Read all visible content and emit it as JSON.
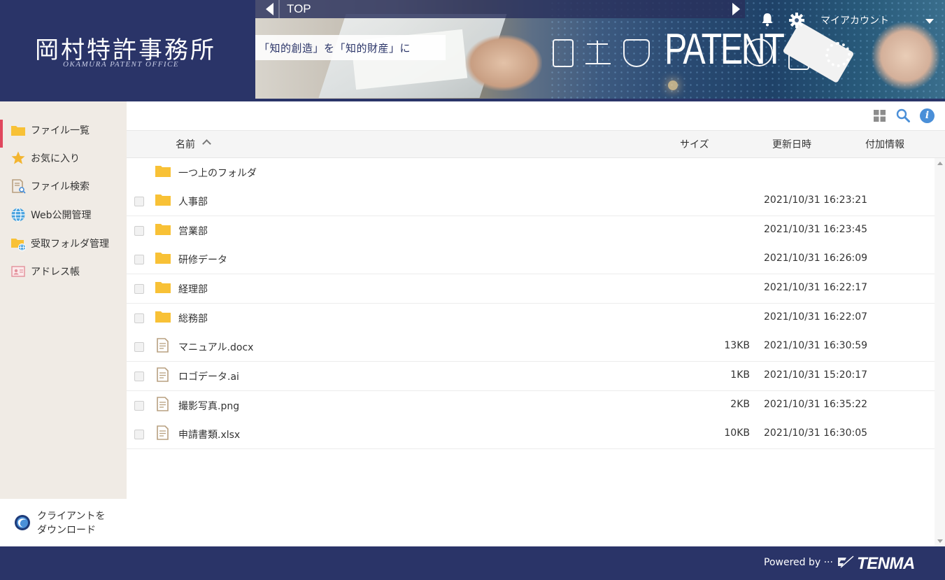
{
  "header": {
    "logo_jp": "岡村特許事務所",
    "logo_en": "OKAMURA PATENT OFFICE",
    "breadcrumb_label": "TOP",
    "tagline": "「知的創造」を「知的財産」に",
    "banner_text": "PATENT",
    "account_label": "マイアカウント"
  },
  "sidebar": {
    "items": [
      {
        "label": "ファイル一覧",
        "icon": "folder-icon"
      },
      {
        "label": "お気に入り",
        "icon": "star-icon"
      },
      {
        "label": "ファイル検索",
        "icon": "file-search-icon"
      },
      {
        "label": "Web公開管理",
        "icon": "globe-icon"
      },
      {
        "label": "受取フォルダ管理",
        "icon": "folder-globe-icon"
      },
      {
        "label": "アドレス帳",
        "icon": "address-book-icon"
      }
    ],
    "active_index": 0,
    "download_label": "クライアントを\nダウンロード"
  },
  "table": {
    "columns": {
      "name": "名前",
      "size": "サイズ",
      "updated": "更新日時",
      "extra": "付加情報"
    },
    "parent_folder": "一つ上のフォルダ",
    "rows": [
      {
        "name": "人事部",
        "type": "folder",
        "size": "",
        "updated": "2021/10/31 16:23:21"
      },
      {
        "name": "営業部",
        "type": "folder",
        "size": "",
        "updated": "2021/10/31 16:23:45"
      },
      {
        "name": "研修データ",
        "type": "folder",
        "size": "",
        "updated": "2021/10/31 16:26:09"
      },
      {
        "name": "経理部",
        "type": "folder",
        "size": "",
        "updated": "2021/10/31 16:22:17"
      },
      {
        "name": "総務部",
        "type": "folder",
        "size": "",
        "updated": "2021/10/31 16:22:07"
      },
      {
        "name": "マニュアル.docx",
        "type": "file",
        "size": "13KB",
        "updated": "2021/10/31 16:30:59"
      },
      {
        "name": "ロゴデータ.ai",
        "type": "file",
        "size": "1KB",
        "updated": "2021/10/31 15:20:17"
      },
      {
        "name": "撮影写真.png",
        "type": "file",
        "size": "2KB",
        "updated": "2021/10/31 16:35:22"
      },
      {
        "name": "申請書類.xlsx",
        "type": "file",
        "size": "10KB",
        "updated": "2021/10/31 16:30:05"
      }
    ]
  },
  "footer": {
    "powered_by": "Powered by ···",
    "brand": "TENMA"
  },
  "colors": {
    "navy": "#2a3468",
    "sidebar_bg": "#f0ebe5",
    "active_accent": "#e0475d",
    "folder": "#f8c136",
    "info_blue": "#4a8fd8"
  }
}
